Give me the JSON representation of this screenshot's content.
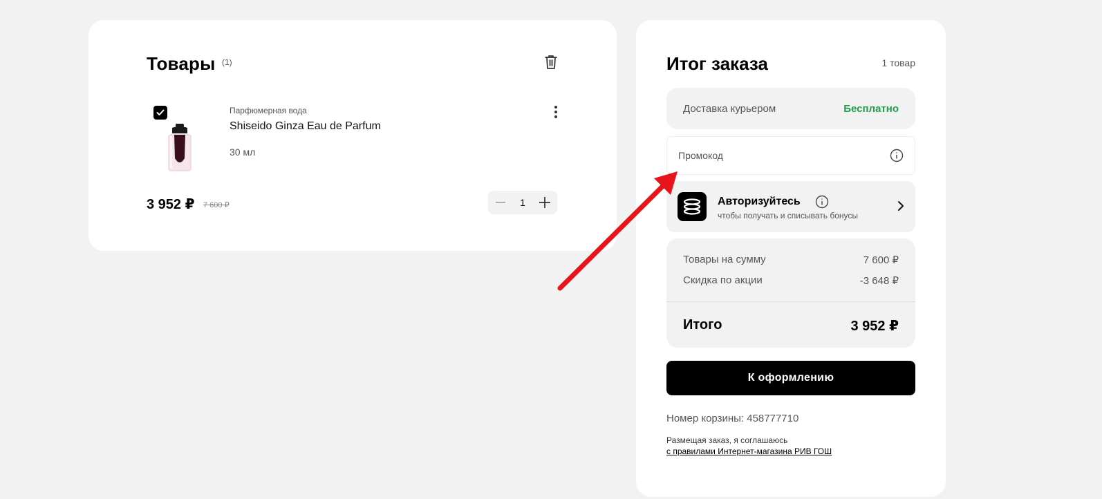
{
  "cart": {
    "title": "Товары",
    "count": "(1)",
    "item": {
      "category": "Парфюмерная вода",
      "name": "Shiseido Ginza Eau de Parfum",
      "volume": "30 мл",
      "checked": true,
      "price": "3 952 ₽",
      "old_price": "7 600 ₽",
      "quantity": "1"
    }
  },
  "summary": {
    "title": "Итог заказа",
    "count": "1 товар",
    "delivery_label": "Доставка курьером",
    "delivery_value": "Бесплатно",
    "promo_placeholder": "Промокод",
    "auth_title": "Авторизуйтесь",
    "auth_subtitle": "чтобы получать и списывать бонусы",
    "subtotal_label": "Товары на сумму",
    "subtotal_value": "7 600 ₽",
    "discount_label": "Скидка по акции",
    "discount_value": "-3 648 ₽",
    "total_label": "Итого",
    "total_value": "3 952 ₽",
    "checkout_button": "К оформлению",
    "cart_number": "Номер корзины: 458777710",
    "terms_text": "Размещая заказ, я соглашаюсь",
    "terms_link": "с правилами Интернет-магазина РИВ ГОШ"
  },
  "icons": {
    "delete": "trash-icon",
    "more": "more-vertical-icon",
    "check": "check-icon",
    "minus": "minus-icon",
    "plus": "plus-icon",
    "info": "info-icon",
    "chevron": "chevron-right-icon",
    "logo": "rivgosh-logo-icon"
  },
  "colors": {
    "background": "#f2f2f2",
    "card": "#ffffff",
    "accent_green": "#1e9e4e",
    "primary_button": "#000000",
    "annotation_arrow": "#e8131b"
  }
}
